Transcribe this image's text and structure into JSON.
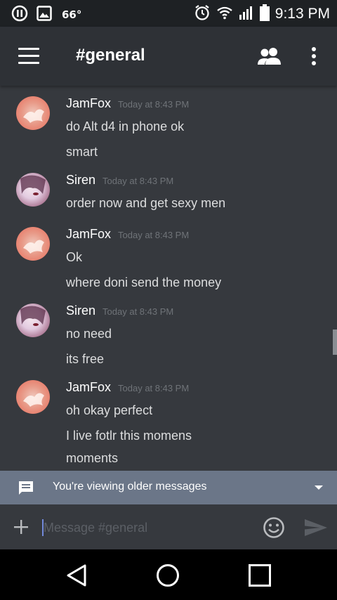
{
  "status_bar": {
    "temperature": "66°",
    "time": "9:13 PM",
    "icons": [
      "pause-icon",
      "image-icon",
      "alarm-icon",
      "wifi-icon",
      "signal-icon",
      "battery-icon"
    ]
  },
  "app_bar": {
    "channel_title": "#general",
    "icons": [
      "menu-icon",
      "members-icon",
      "overflow-menu-icon"
    ]
  },
  "messages": [
    {
      "author": "JamFox",
      "timestamp": "Today at 8:43 PM",
      "lines": [
        "do Alt d4 in phone ok",
        "smart"
      ]
    },
    {
      "author": "Siren",
      "timestamp": "Today at 8:43 PM",
      "lines": [
        "order now and get sexy men"
      ]
    },
    {
      "author": "JamFox",
      "timestamp": "Today at 8:43 PM",
      "lines": [
        "Ok",
        "where doni send the money"
      ]
    },
    {
      "author": "Siren",
      "timestamp": "Today at 8:43 PM",
      "lines": [
        "no need",
        "its free"
      ]
    },
    {
      "author": "JamFox",
      "timestamp": "Today at 8:43 PM",
      "lines": [
        "oh okay perfect",
        "I live fotlr this momens",
        "moments"
      ]
    }
  ],
  "older_banner": {
    "text": "You're viewing older messages"
  },
  "composer": {
    "placeholder": "Message #general",
    "value": ""
  },
  "colors": {
    "background": "#36393e",
    "app_bar": "#2e3136",
    "banner": "#6b7688",
    "accent": "#7289da"
  }
}
